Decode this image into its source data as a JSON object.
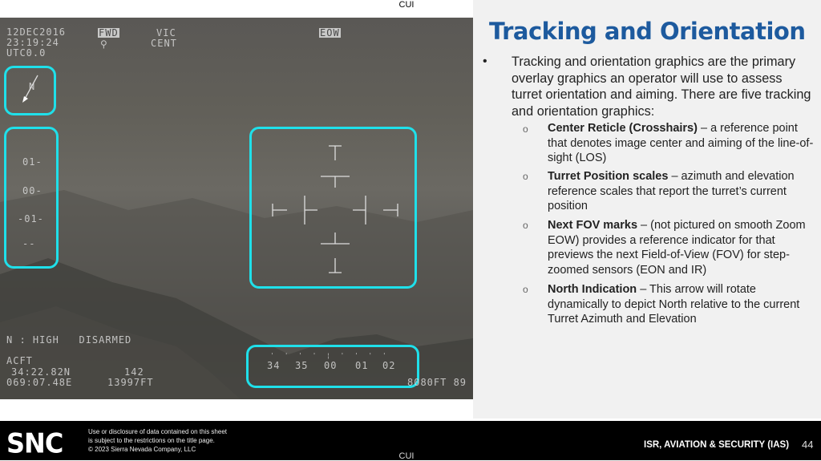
{
  "classification": {
    "top": "CUI",
    "bottom": "CUI"
  },
  "video": {
    "date": "12DEC2016",
    "time": "23:19:24",
    "utc": "UTC0.0",
    "fwd": "FWD",
    "vic": "VIC",
    "cent": "CENT",
    "sensor": "EOW",
    "north_label": "N",
    "elev_scale": [
      "01-",
      "00-",
      "-01-",
      "--"
    ],
    "status": "N : HIGH   DISARMED",
    "acft": "ACFT",
    "lat": "34:22.82N",
    "lon": "069:07.48E",
    "heading": "142",
    "alt": "13997FT",
    "az_scale": [
      "34",
      "35",
      "00",
      "01",
      "02"
    ],
    "range": "8080FT 89"
  },
  "slide": {
    "title": "Tracking and Orientation",
    "intro": "Tracking and orientation graphics are the primary overlay graphics an operator will use to assess turret orientation and aiming. There are five tracking and orientation graphics:",
    "items": [
      {
        "term": "Center Reticle (Crosshairs)",
        "desc": " – a reference point that denotes image center and aiming of the line-of-sight (LOS)"
      },
      {
        "term": "Turret Position scales",
        "desc": " – azimuth and elevation reference scales that report the turret’s current position"
      },
      {
        "term": "Next FOV marks",
        "desc": " – (not pictured on smooth Zoom EOW) provides a reference indicator for that previews the next Field-of-View (FOV) for step-zoomed sensors (EON and IR)"
      },
      {
        "term": "North Indication",
        "desc": " – This arrow will rotate dynamically to depict North relative to the current Turret Azimuth and Elevation"
      }
    ]
  },
  "footer": {
    "logo": "SNC",
    "disclaimer": [
      "Use or disclosure of data contained on this sheet",
      "is subject to the restrictions on the title page.",
      "© 2023 Sierra Nevada Company, LLC"
    ],
    "org": "ISR, AVIATION & SECURITY (IAS)",
    "page": "44"
  },
  "colors": {
    "highlight": "#1fe0ea",
    "title": "#1d5a9e"
  }
}
